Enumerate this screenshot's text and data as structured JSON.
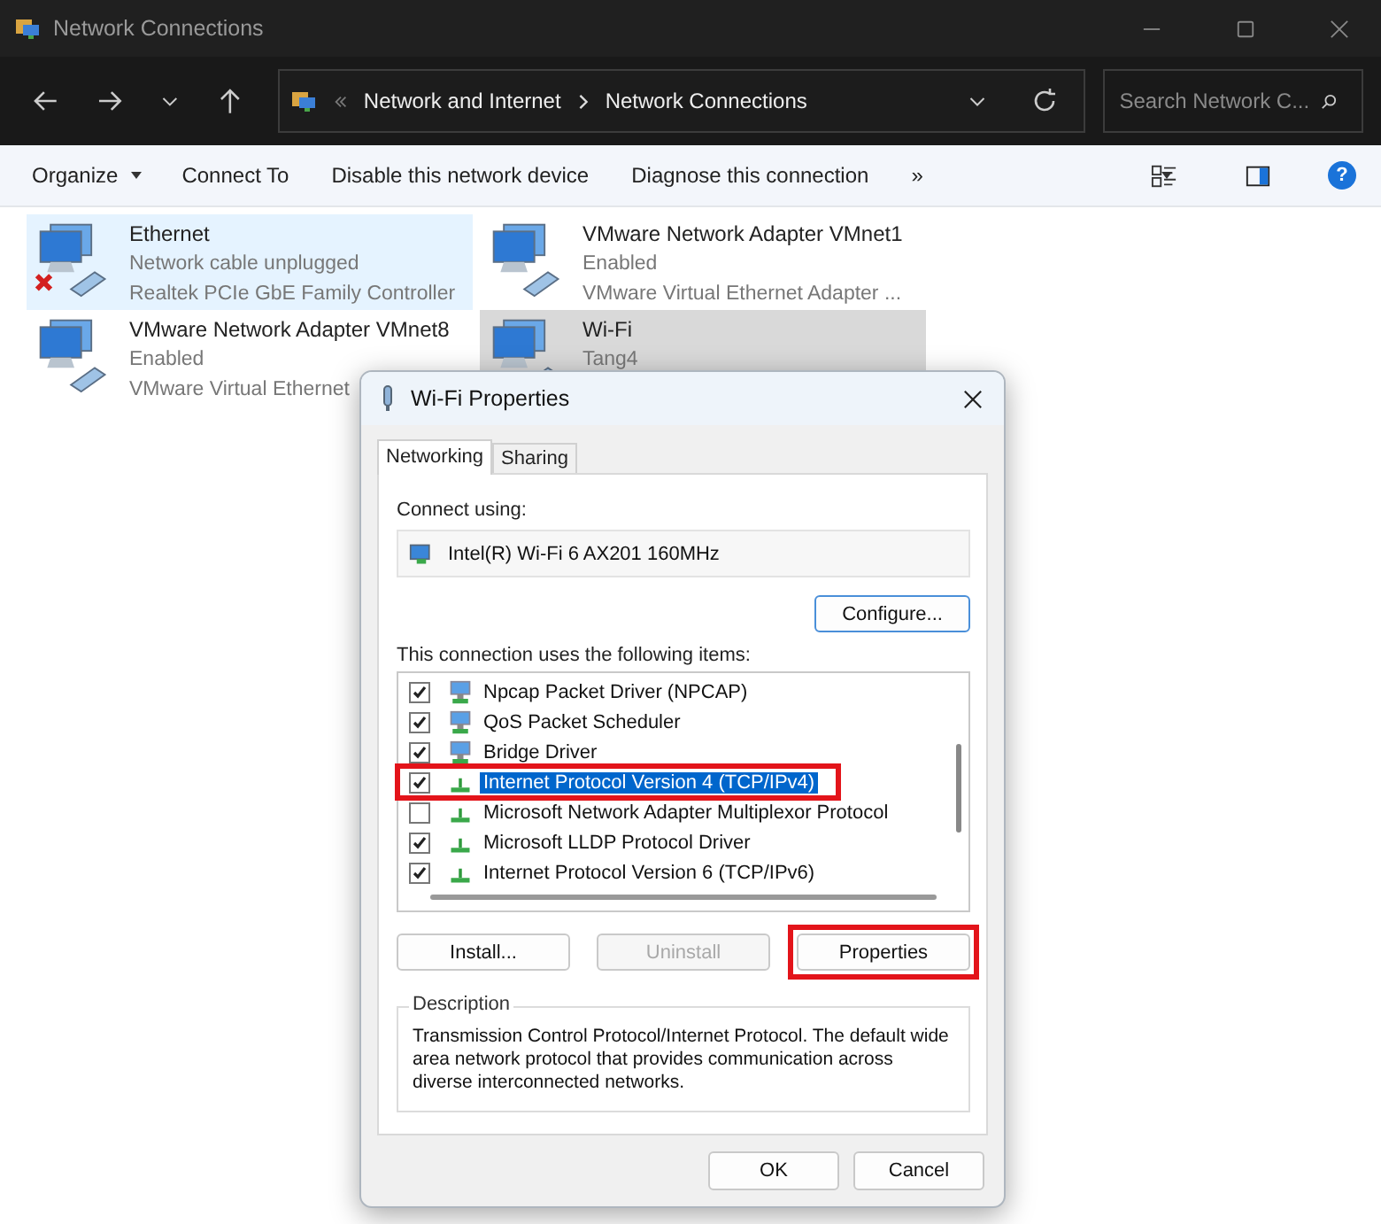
{
  "window": {
    "title": "Network Connections"
  },
  "address": {
    "crumbs": [
      "Network and Internet",
      "Network Connections"
    ],
    "search_placeholder": "Search Network C..."
  },
  "toolbar": {
    "items": [
      "Organize",
      "Connect To",
      "Disable this network device",
      "Diagnose this connection"
    ],
    "more": "»",
    "help": "?"
  },
  "adapters": [
    {
      "name": "Ethernet",
      "status": "Network cable unplugged",
      "device": "Realtek PCIe GbE Family Controller",
      "hovered": true,
      "selected": false,
      "disconnected": true
    },
    {
      "name": "VMware Network Adapter VMnet1",
      "status": "Enabled",
      "device": "VMware Virtual Ethernet Adapter ...",
      "hovered": false,
      "selected": false,
      "disconnected": false
    },
    {
      "name": "VMware Network Adapter VMnet8",
      "status": "Enabled",
      "device": "VMware Virtual Ethernet",
      "hovered": false,
      "selected": false,
      "disconnected": false
    },
    {
      "name": "Wi-Fi",
      "status": "Tang4",
      "hovered": false,
      "selected": true,
      "disconnected": false
    }
  ],
  "dialog": {
    "title": "Wi-Fi Properties",
    "tabs": [
      {
        "label": "Networking",
        "selected": true
      },
      {
        "label": "Sharing",
        "selected": false
      }
    ],
    "connect_using_label": "Connect using:",
    "adapter": "Intel(R) Wi-Fi 6 AX201 160MHz",
    "configure": "Configure...",
    "items_label": "This connection uses the following items:",
    "items": [
      {
        "label": "Npcap Packet Driver (NPCAP)",
        "kind": "service",
        "checked": true,
        "selected": false,
        "annotated": false
      },
      {
        "label": "QoS Packet Scheduler",
        "kind": "service",
        "checked": true,
        "selected": false,
        "annotated": false
      },
      {
        "label": "Bridge Driver",
        "kind": "service",
        "checked": true,
        "selected": false,
        "annotated": false
      },
      {
        "label": "Internet Protocol Version 4 (TCP/IPv4)",
        "kind": "protocol",
        "checked": true,
        "selected": true,
        "annotated": true
      },
      {
        "label": "Microsoft Network Adapter Multiplexor Protocol",
        "kind": "protocol",
        "checked": false,
        "selected": false,
        "annotated": false
      },
      {
        "label": "Microsoft LLDP Protocol Driver",
        "kind": "protocol",
        "checked": true,
        "selected": false,
        "annotated": false
      },
      {
        "label": "Internet Protocol Version 6 (TCP/IPv6)",
        "kind": "protocol",
        "checked": true,
        "selected": false,
        "annotated": false
      }
    ],
    "buttons": [
      {
        "label": "Install...",
        "disabled": false,
        "annotated": false
      },
      {
        "label": "Uninstall",
        "disabled": true,
        "annotated": false
      },
      {
        "label": "Properties",
        "disabled": false,
        "annotated": true
      }
    ],
    "description_label": "Description",
    "description": "Transmission Control Protocol/Internet Protocol. The default wide area network protocol that provides communication across diverse interconnected networks.",
    "footer": [
      "OK",
      "Cancel"
    ]
  }
}
